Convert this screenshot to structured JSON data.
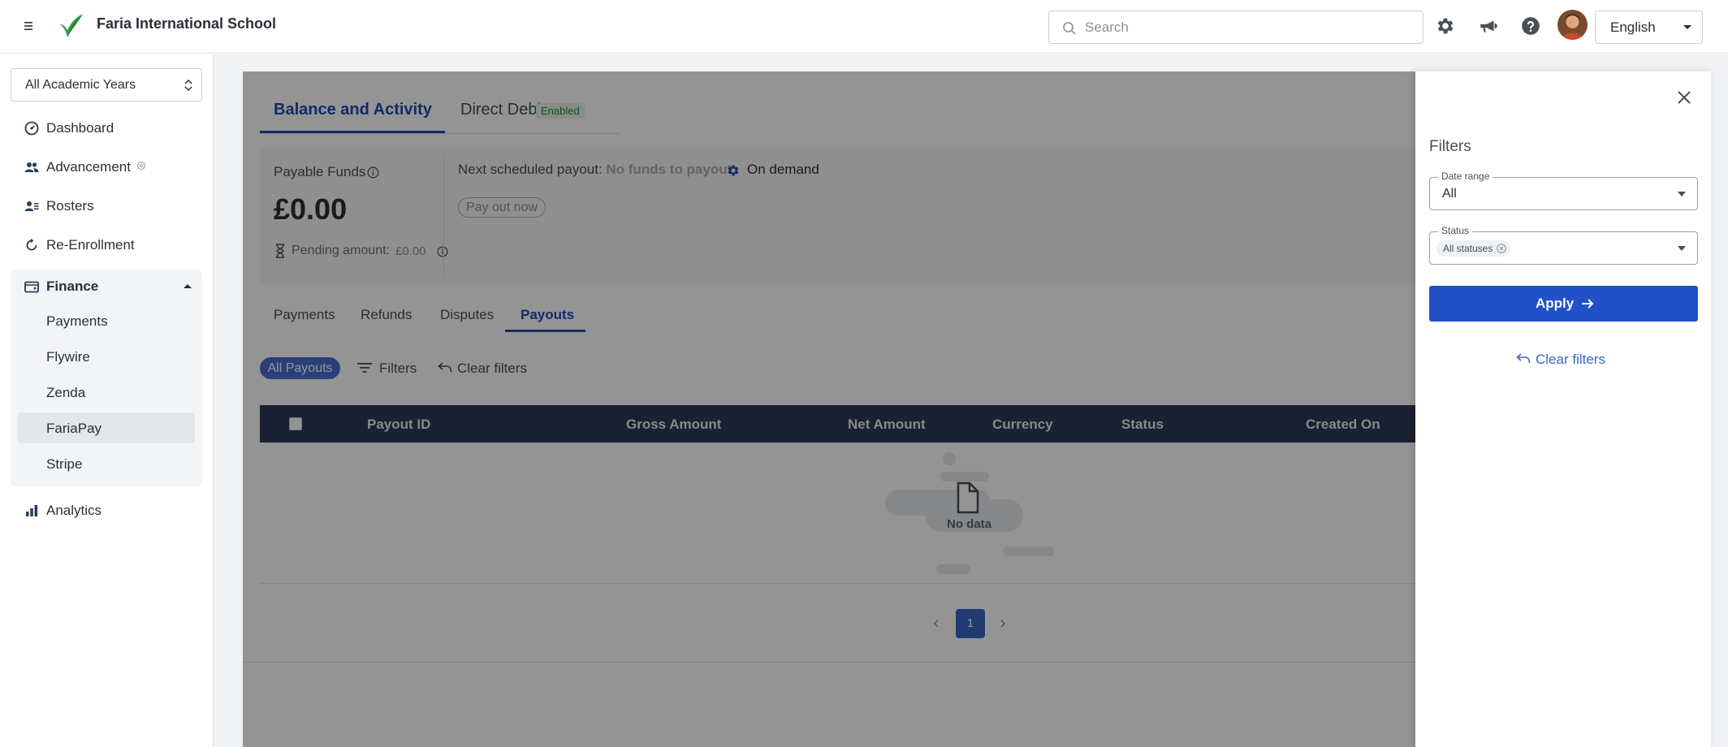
{
  "header": {
    "school_name": "Faria International School",
    "search_placeholder": "Search",
    "language": "English"
  },
  "sidebar": {
    "academic_year": "All Academic Years",
    "items": [
      {
        "label": "Dashboard",
        "icon": "dashboard-icon"
      },
      {
        "label": "Advancement",
        "icon": "users-icon"
      },
      {
        "label": "Rosters",
        "icon": "roster-icon"
      },
      {
        "label": "Re-Enrollment",
        "icon": "refresh-icon"
      }
    ],
    "finance": {
      "label": "Finance",
      "sub_items": [
        "Payments",
        "Flywire",
        "Zenda",
        "FariaPay",
        "Stripe"
      ],
      "active": "FariaPay"
    },
    "analytics": "Analytics"
  },
  "main": {
    "tabs": [
      {
        "label": "Balance and Activity",
        "active": true
      },
      {
        "label": "Direct Debit",
        "badge": "Enabled"
      }
    ],
    "payable_funds_label": "Payable Funds",
    "payable_funds_amount": "£0.00",
    "pending_label": "Pending amount:",
    "pending_value": "£0.00",
    "next_payout_label": "Next scheduled payout:",
    "next_payout_value": "No funds to payout",
    "on_demand": "On demand",
    "pay_out_button": "Pay out now",
    "subtabs": [
      "Payments",
      "Refunds",
      "Disputes",
      "Payouts"
    ],
    "active_subtab": "Payouts",
    "chip_all_payouts": "All Payouts",
    "filters_label": "Filters",
    "clear_filters_label": "Clear filters",
    "table_columns": [
      "Payout ID",
      "Gross Amount",
      "Net Amount",
      "Currency",
      "Status",
      "Created On"
    ],
    "empty_text": "No data",
    "current_page": "1"
  },
  "drawer": {
    "title": "Filters",
    "date_range_label": "Date range",
    "date_range_value": "All",
    "status_label": "Status",
    "status_chip": "All statuses",
    "apply_label": "Apply",
    "clear_label": "Clear filters"
  },
  "colors": {
    "accent": "#2150c8",
    "table_header": "#2b3a57",
    "overlay": "rgba(0,0,0,0.42)"
  }
}
